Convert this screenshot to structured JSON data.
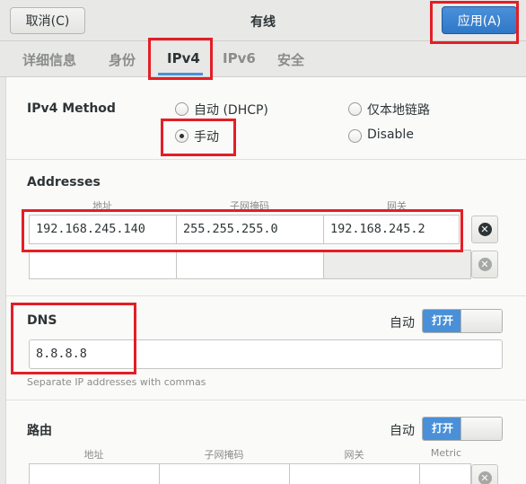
{
  "header": {
    "title": "有线",
    "cancel_label": "取消(C)",
    "apply_label": "应用(A)"
  },
  "tabs": [
    {
      "label": "详细信息"
    },
    {
      "label": "身份"
    },
    {
      "label": "IPv4"
    },
    {
      "label": "IPv6"
    },
    {
      "label": "安全"
    }
  ],
  "ipv4": {
    "method_label": "IPv4 Method",
    "methods": [
      {
        "label": "自动 (DHCP)",
        "checked": false
      },
      {
        "label": "仅本地链路",
        "checked": false
      },
      {
        "label": "手动",
        "checked": true
      },
      {
        "label": "Disable",
        "checked": false
      }
    ]
  },
  "addresses": {
    "label": "Addresses",
    "col_address": "地址",
    "col_netmask": "子网掩码",
    "col_gateway": "网关",
    "rows": [
      {
        "address": "192.168.245.140",
        "netmask": "255.255.255.0",
        "gateway": "192.168.245.2"
      },
      {
        "address": "",
        "netmask": "",
        "gateway": ""
      }
    ]
  },
  "dns": {
    "label": "DNS",
    "auto_label": "自动",
    "toggle_label": "打开",
    "value": "8.8.8.8",
    "hint": "Separate IP addresses with commas"
  },
  "routes": {
    "label": "路由",
    "auto_label": "自动",
    "toggle_label": "打开",
    "col_address": "地址",
    "col_netmask": "子网掩码",
    "col_gateway": "网关",
    "col_metric": "Metric"
  },
  "colors": {
    "accent": "#4a90d9",
    "highlight": "#e41e26"
  }
}
